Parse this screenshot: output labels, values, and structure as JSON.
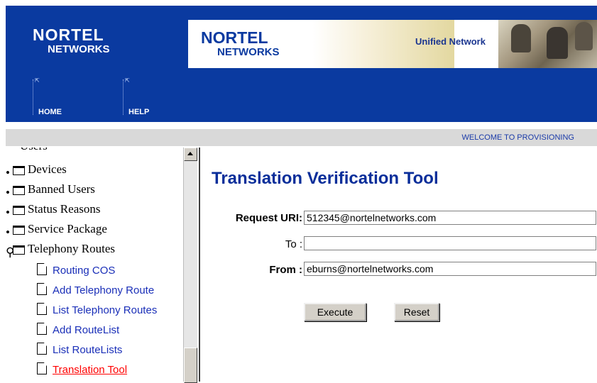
{
  "header": {
    "logo": {
      "line1": "NORTEL",
      "line2": "NETWORKS"
    },
    "banner": {
      "line1": "NORTEL",
      "line2": "NETWORKS",
      "tagline": "Unified Network"
    },
    "nav": [
      {
        "label": "HOME"
      },
      {
        "label": "HELP"
      }
    ],
    "welcome": "WELCOME TO PROVISIONING",
    "colors": {
      "header_bg": "#0a3aa0",
      "title": "#0a2e9a",
      "link": "#1a2fb8",
      "active_link": "#ff0000"
    }
  },
  "sidebar": {
    "partial_top": "Users",
    "folders": [
      {
        "label": "Devices",
        "expanded": false
      },
      {
        "label": "Banned Users",
        "expanded": false
      },
      {
        "label": "Status Reasons",
        "expanded": false
      },
      {
        "label": "Service Package",
        "expanded": false
      },
      {
        "label": "Telephony Routes",
        "expanded": true
      }
    ],
    "items": [
      {
        "label": "Routing COS",
        "active": false
      },
      {
        "label": "Add Telephony Route",
        "active": false
      },
      {
        "label": "List Telephony Routes",
        "active": false
      },
      {
        "label": "Add RouteList",
        "active": false
      },
      {
        "label": "List RouteLists",
        "active": false
      },
      {
        "label": "Translation Tool",
        "active": true
      }
    ]
  },
  "main": {
    "title": "Translation Verification Tool",
    "fields": [
      {
        "label": "Request URI:",
        "value": "512345@nortelnetworks.com"
      },
      {
        "label": "To :",
        "value": ""
      },
      {
        "label": "From :",
        "value": "eburns@nortelnetworks.com"
      }
    ],
    "buttons": {
      "execute": "Execute",
      "reset": "Reset"
    }
  }
}
